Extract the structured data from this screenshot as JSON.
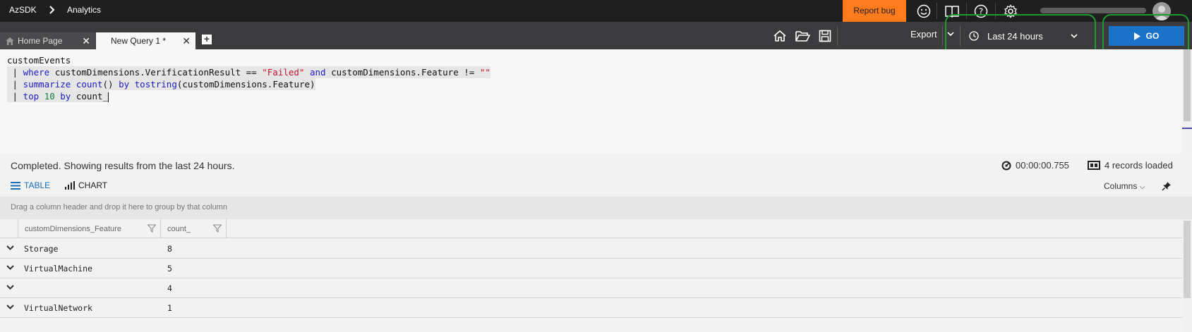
{
  "app": {
    "name": "AzSDK",
    "section": "Analytics"
  },
  "topbar": {
    "report_bug": "Report bug",
    "icons": [
      "smiley-icon",
      "book-icon",
      "help-icon",
      "settings-icon"
    ],
    "user_name_redacted": true
  },
  "tabs": [
    {
      "label": "Home Page",
      "icon": "home-icon",
      "active": false
    },
    {
      "label": "New Query 1 *",
      "active": true
    }
  ],
  "toolbar": {
    "tools": [
      "home-icon",
      "open-folder-icon",
      "save-icon"
    ],
    "export_label": "Export",
    "time_range": "Last 24 hours",
    "go_label": "GO"
  },
  "editor": {
    "lines": [
      [
        {
          "t": "customEvents",
          "c": "plain"
        }
      ],
      [
        {
          "t": " | ",
          "c": "plain"
        },
        {
          "t": "where",
          "c": "kw"
        },
        {
          "t": " customDimensions.VerificationResult == ",
          "c": "plain"
        },
        {
          "t": "\"Failed\"",
          "c": "str"
        },
        {
          "t": " ",
          "c": "plain"
        },
        {
          "t": "and",
          "c": "kw"
        },
        {
          "t": " customDimensions.Feature != ",
          "c": "plain"
        },
        {
          "t": "\"\"",
          "c": "str"
        }
      ],
      [
        {
          "t": " | ",
          "c": "plain"
        },
        {
          "t": "summarize",
          "c": "kw"
        },
        {
          "t": " ",
          "c": "plain"
        },
        {
          "t": "count",
          "c": "kw"
        },
        {
          "t": "() ",
          "c": "plain"
        },
        {
          "t": "by",
          "c": "kw"
        },
        {
          "t": " ",
          "c": "plain"
        },
        {
          "t": "tostring",
          "c": "kw"
        },
        {
          "t": "(customDimensions.Feature)",
          "c": "plain"
        }
      ],
      [
        {
          "t": " | ",
          "c": "plain"
        },
        {
          "t": "top",
          "c": "kw"
        },
        {
          "t": " ",
          "c": "plain"
        },
        {
          "t": "10",
          "c": "num"
        },
        {
          "t": " ",
          "c": "plain"
        },
        {
          "t": "by",
          "c": "kw"
        },
        {
          "t": " count_",
          "c": "plain"
        }
      ]
    ]
  },
  "results": {
    "status": "Completed. Showing results from the last 24 hours.",
    "duration": "00:00:00.755",
    "records": "4 records loaded",
    "view_tabs": {
      "table": "TABLE",
      "chart": "CHART",
      "active": "table"
    },
    "columns_label": "Columns",
    "group_hint": "Drag a column header and drop it here to group by that column",
    "columns": [
      "customDimensions_Feature",
      "count_"
    ],
    "rows": [
      [
        "Storage",
        "8"
      ],
      [
        "VirtualMachine",
        "5"
      ],
      [
        "",
        "4"
      ],
      [
        "VirtualNetwork",
        "1"
      ]
    ]
  },
  "colors": {
    "accent_go": "#1a73c8",
    "report_bug": "#ff7b1c",
    "highlight": "#1e9a35",
    "keyword": "#1b1bc2",
    "string": "#c0152b",
    "number": "#15803d"
  }
}
